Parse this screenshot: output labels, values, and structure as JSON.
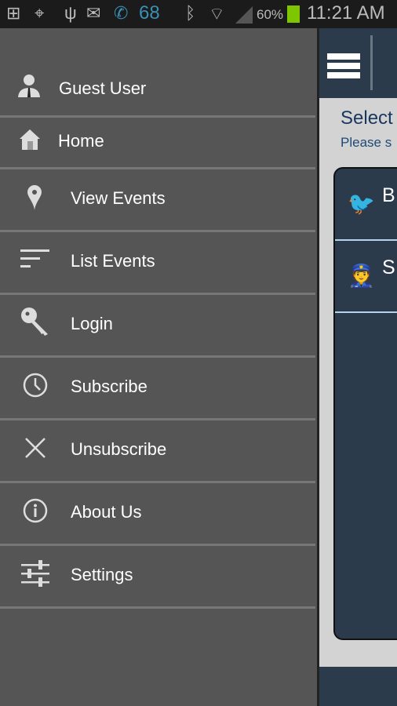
{
  "status_bar": {
    "signal_number": "68",
    "battery": "60%",
    "time": "11:21 AM"
  },
  "drawer": {
    "items": [
      {
        "label": "Guest User",
        "icon": "user-icon"
      },
      {
        "label": "Home",
        "icon": "home-icon"
      },
      {
        "label": "View Events",
        "icon": "map-pin-icon"
      },
      {
        "label": "List Events",
        "icon": "list-icon"
      },
      {
        "label": "Login",
        "icon": "key-icon"
      },
      {
        "label": "Subscribe",
        "icon": "clock-icon"
      },
      {
        "label": "Unsubscribe",
        "icon": "close-icon"
      },
      {
        "label": "About Us",
        "icon": "info-icon"
      },
      {
        "label": "Settings",
        "icon": "sliders-icon"
      }
    ]
  },
  "main": {
    "title": "Select",
    "subtitle": "Please s",
    "list": [
      {
        "label": "B",
        "icon": "birds-icon"
      },
      {
        "label": "S",
        "icon": "police-icon"
      }
    ]
  },
  "colors": {
    "drawer": "#555555",
    "navy": "#2c3b4c",
    "content": "#d3d3d3",
    "title": "#17375e",
    "divider": "#b6d3ee"
  }
}
